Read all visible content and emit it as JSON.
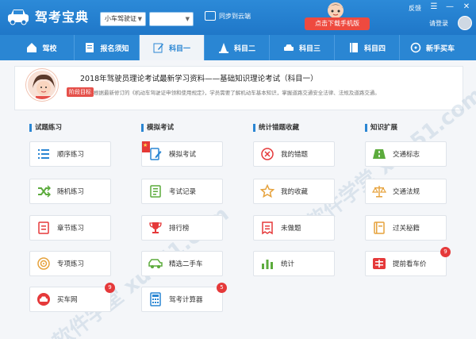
{
  "app": {
    "title": "驾考宝典"
  },
  "topbar": {
    "license_select": "小车驾驶证",
    "city_select": "",
    "sync_label": "同步到云端",
    "download_label": "点击下载手机版",
    "feedback": "反馈",
    "login": "请登录",
    "menu_glyph": "☰",
    "minimize_glyph": "—",
    "close_glyph": "✕"
  },
  "nav": {
    "tabs": [
      {
        "label": "驾校"
      },
      {
        "label": "报名须知"
      },
      {
        "label": "科目一"
      },
      {
        "label": "科目二"
      },
      {
        "label": "科目三"
      },
      {
        "label": "科目四"
      },
      {
        "label": "新手买车"
      }
    ],
    "active_index": 2
  },
  "banner": {
    "title": "2018年驾驶员理论考试最新学习资料——基础知识理论考试（科目一）",
    "badge": "阶段目标",
    "desc": "根据最新修订的《机动车驾驶证申领和使用规定》，学员需要了解机动车基本知识，掌握道路交通安全法律、法规及道路交通。"
  },
  "sections": [
    {
      "title": "试题练习",
      "items": [
        {
          "label": "顺序练习",
          "icon": "list-icon"
        },
        {
          "label": "随机练习",
          "icon": "shuffle-icon"
        },
        {
          "label": "章节练习",
          "icon": "chapter-icon"
        },
        {
          "label": "专项练习",
          "icon": "target-icon"
        },
        {
          "label": "买车网",
          "icon": "car-shop-icon",
          "badge": "9"
        }
      ]
    },
    {
      "title": "模拟考试",
      "items": [
        {
          "label": "模拟考试",
          "icon": "exam-icon",
          "ribbon": true
        },
        {
          "label": "考试记录",
          "icon": "record-icon"
        },
        {
          "label": "排行榜",
          "icon": "trophy-icon"
        },
        {
          "label": "精选二手车",
          "icon": "used-car-icon"
        },
        {
          "label": "驾考计算器",
          "icon": "calculator-icon",
          "badge": "5"
        }
      ]
    },
    {
      "title": "统计错题收藏",
      "items": [
        {
          "label": "我的错题",
          "icon": "wrong-icon"
        },
        {
          "label": "我的收藏",
          "icon": "star-icon"
        },
        {
          "label": "未做题",
          "icon": "undone-icon"
        },
        {
          "label": "统计",
          "icon": "stats-icon"
        }
      ]
    },
    {
      "title": "知识扩展",
      "items": [
        {
          "label": "交通标志",
          "icon": "road-sign-icon"
        },
        {
          "label": "交通法规",
          "icon": "law-icon"
        },
        {
          "label": "过关秘籍",
          "icon": "guide-icon"
        },
        {
          "label": "提前看车价",
          "icon": "car-price-icon",
          "badge": "9"
        }
      ]
    }
  ],
  "watermark": "软件学堂 xue51.com",
  "colors": {
    "brand": "#2a86d3",
    "accent_red": "#e5393a",
    "icon_green": "#5cab3c",
    "icon_blue": "#2a86d3",
    "icon_orange": "#e6a23c"
  }
}
